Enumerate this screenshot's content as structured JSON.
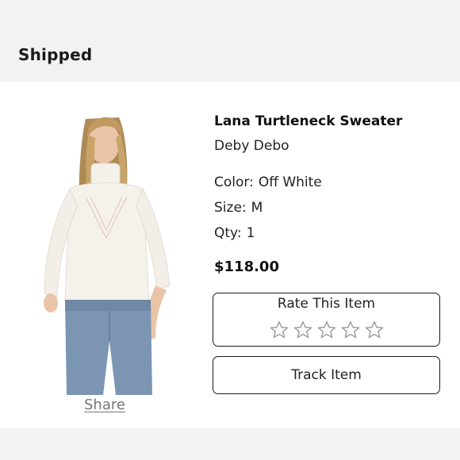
{
  "header": {
    "status": "Shipped"
  },
  "product": {
    "name": "Lana Turtleneck Sweater",
    "brand": "Deby Debo",
    "color_label": "Color:",
    "color_value": "Off White",
    "size_label": "Size:",
    "size_value": "M",
    "qty_label": "Qty:",
    "qty_value": "1",
    "price": "$118.00"
  },
  "actions": {
    "share_label": "Share",
    "rate_label": "Rate This Item",
    "rating": {
      "value": 0,
      "max": 5
    },
    "track_label": "Track Item"
  },
  "icons": {
    "star": "star-outline-icon"
  },
  "colors": {
    "header_bg": "#f2f2f2",
    "text": "#1a1a1a",
    "muted_link": "#777777",
    "border": "#1c1c1c",
    "star_outline": "#9a9a9a"
  }
}
